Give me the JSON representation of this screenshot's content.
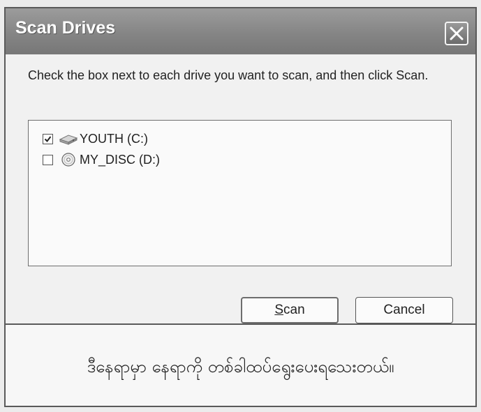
{
  "window": {
    "title": "Scan Drives",
    "close_icon": "close-icon"
  },
  "dialog": {
    "instructions": "Check the box next to each drive you want to scan, and then click Scan.",
    "drives": [
      {
        "label": "YOUTH (C:)",
        "checked": true,
        "icon": "hard-drive-icon"
      },
      {
        "label": "MY_DISC (D:)",
        "checked": false,
        "icon": "cd-drive-icon"
      }
    ],
    "buttons": {
      "scan": "Scan",
      "cancel": "Cancel"
    }
  },
  "caption": "ဒီနေရာမှာ နေရာကို တစ်ခါထပ်ရွေးပေးရသေးတယ်။"
}
